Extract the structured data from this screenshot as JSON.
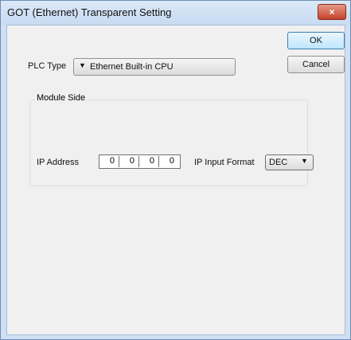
{
  "window": {
    "title": "GOT (Ethernet) Transparent Setting",
    "close_glyph": "×"
  },
  "buttons": {
    "ok_label": "OK",
    "cancel_label": "Cancel"
  },
  "plc_type": {
    "label": "PLC Type",
    "value": "Ethernet Built-in CPU",
    "arrow_glyph": "▼"
  },
  "module_side": {
    "group_title": "Module Side",
    "ip_address_label": "IP Address",
    "ip_octets": [
      "0",
      "0",
      "0",
      "0"
    ],
    "ip_input_format_label": "IP Input Format",
    "ip_input_format_value": "DEC",
    "arrow_glyph": "▼"
  }
}
